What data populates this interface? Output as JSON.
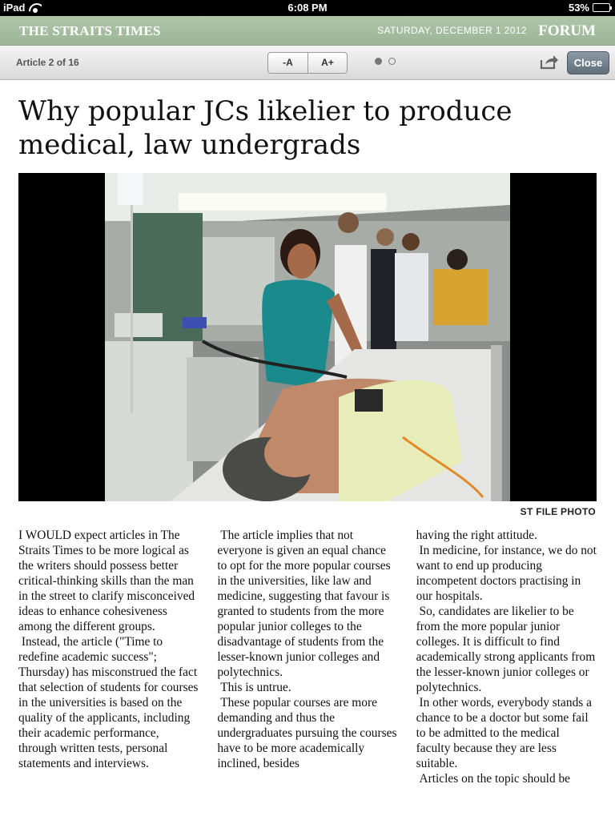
{
  "status_bar": {
    "device": "iPad",
    "time": "6:08 PM",
    "battery_percent": "53%",
    "battery_level": 0.53
  },
  "masthead": {
    "brand": "THE STRAITS TIMES",
    "date": "SATURDAY, DECEMBER 1 2012",
    "section": "FORUM"
  },
  "toolbar": {
    "article_counter": "Article 2 of 16",
    "font_decrease_label": "-A",
    "font_increase_label": "A+",
    "page_dots": 2,
    "active_page": 1,
    "close_label": "Close"
  },
  "article": {
    "headline": "Why popular JCs likelier to produce medical, law undergrads",
    "photo_credit": "ST FILE PHOTO",
    "columns": [
      [
        "I WOULD expect articles in The Straits Times to be more logical as the writers should possess better critical-thinking skills than the man in the street to clarify misconceived ideas to enhance cohesiveness among the different groups.",
        "Instead, the article (\"Time to redefine academic success\"; Thursday) has misconstrued the fact that selection of students for courses in the universities is based on the quality of the applicants, including their academic performance, through written tests, personal statements and interviews."
      ],
      [
        "The article implies that not everyone is given an equal chance to opt for the more popular courses in the universities, like law and medicine, suggesting that favour is granted to students from the more popular junior colleges to the disadvantage of students from the lesser-known junior colleges and polytechnics.",
        "This is untrue.",
        "These popular courses are more demanding and thus the undergraduates pursuing the courses have to be more academically inclined, besides"
      ],
      [
        "having the right attitude.",
        "In medicine, for instance, we do not want to end up producing incompetent doctors practising in our hospitals.",
        "So, candidates are likelier to be from the more popular junior colleges. It is difficult to find academically strong applicants from the lesser-known junior colleges or polytechnics.",
        "In other words, everybody stands a chance to be a doctor but some fail to be admitted to the medical faculty because they are less suitable.",
        "Articles on the topic should be"
      ]
    ]
  }
}
